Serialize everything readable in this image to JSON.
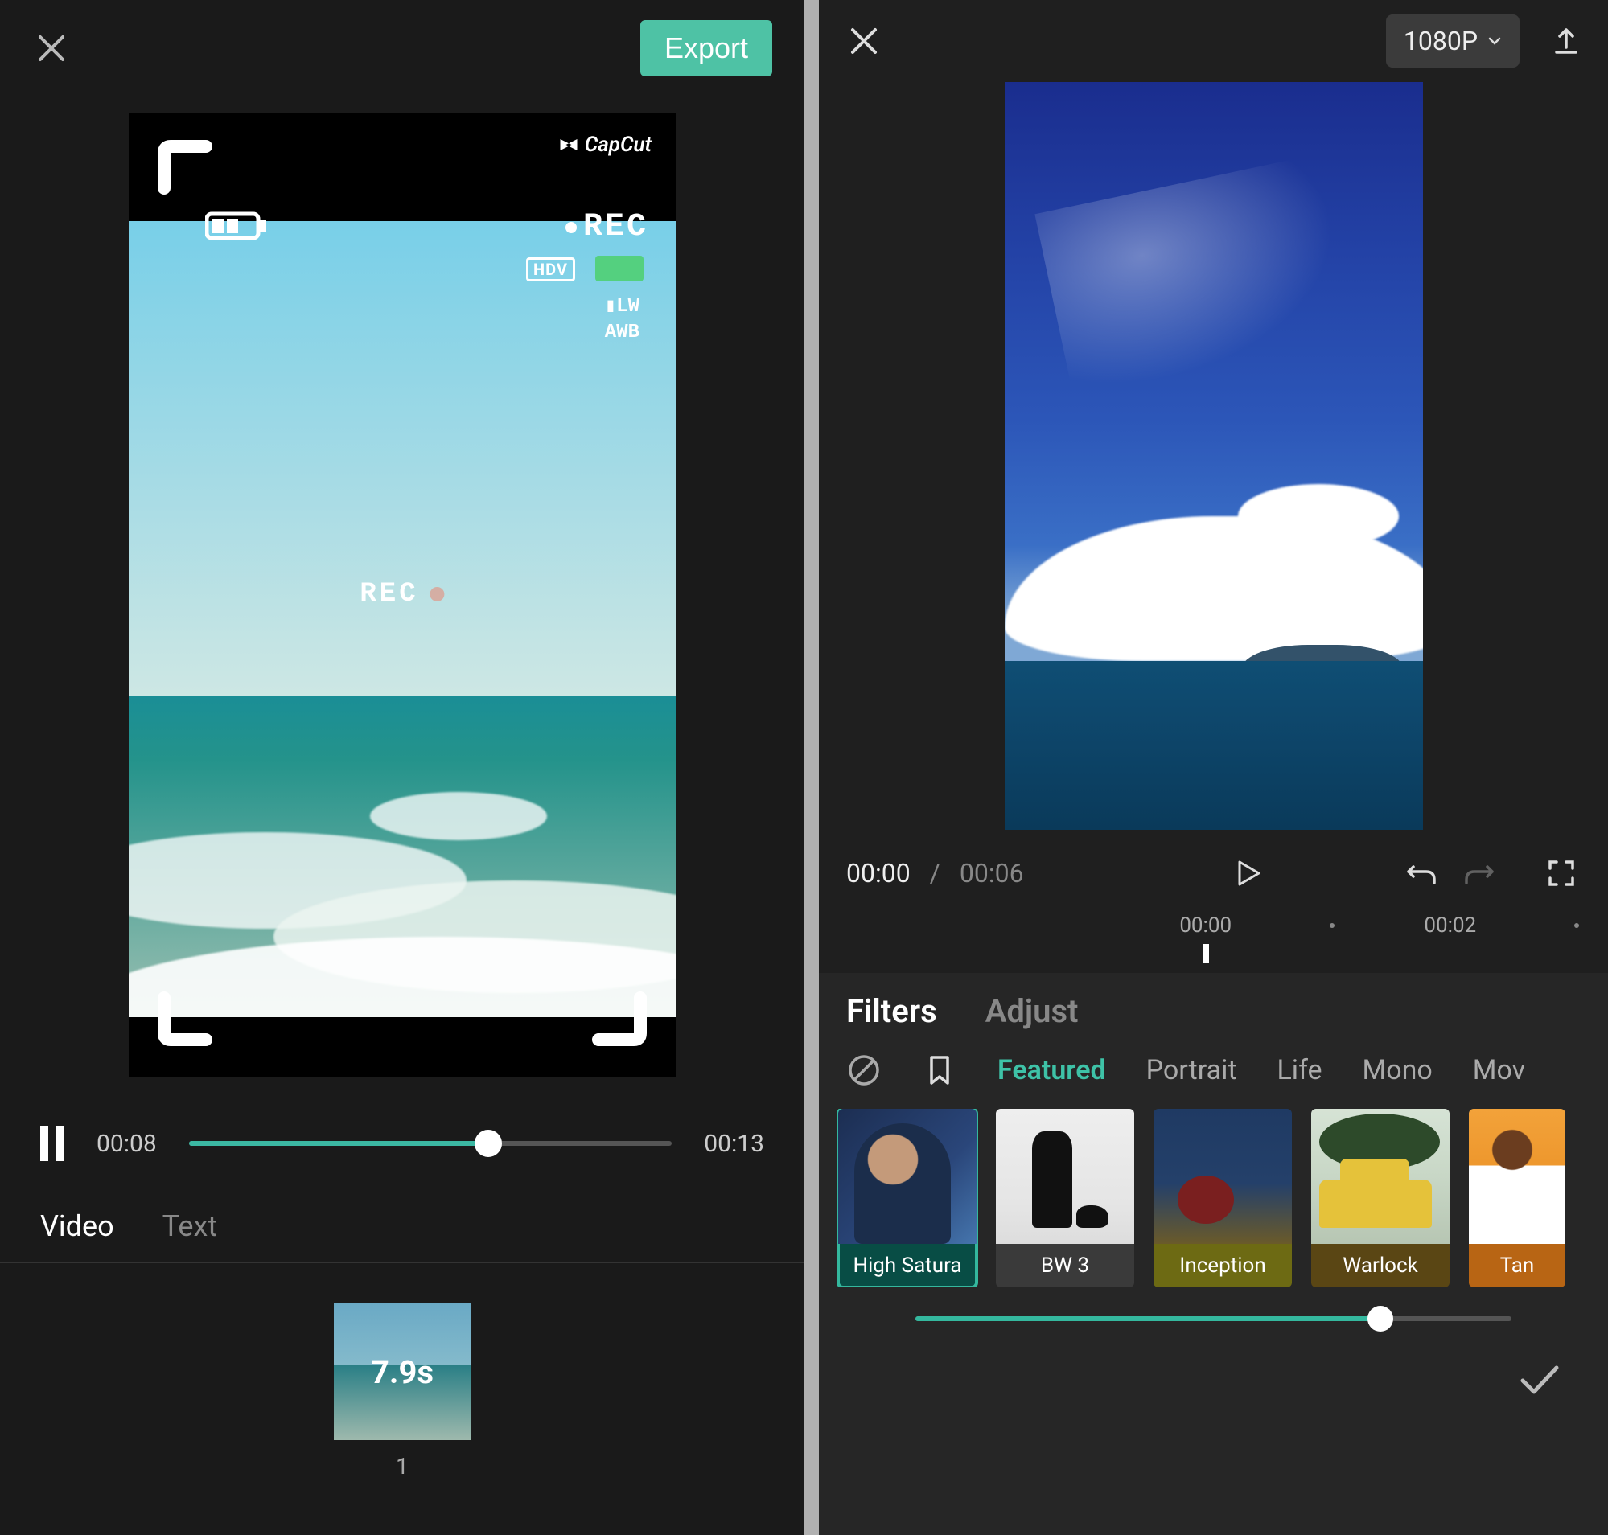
{
  "left": {
    "export_label": "Export",
    "overlay": {
      "brand": "CapCut",
      "rec_badge": "REC",
      "hdv": "HDV",
      "lw": "▮LW",
      "awb": "AWB",
      "rec_center": "REC"
    },
    "controls": {
      "current_time": "00:08",
      "total_time": "00:13",
      "progress_pct": 62
    },
    "tabs": {
      "video": "Video",
      "text": "Text",
      "active": "video"
    },
    "clip": {
      "duration_label": "7.9s",
      "index_label": "1"
    }
  },
  "right": {
    "resolution_label": "1080P",
    "controls": {
      "current_time": "00:00",
      "total_time": "00:06"
    },
    "timeline": {
      "ticks": [
        "00:00",
        "00:02"
      ]
    },
    "panel_tabs": {
      "filters": "Filters",
      "adjust": "Adjust",
      "active": "filters"
    },
    "categories": {
      "items": [
        "Featured",
        "Portrait",
        "Life",
        "Mono",
        "Mov"
      ],
      "active_index": 0
    },
    "filters": [
      {
        "label": "High Satura",
        "selected": true
      },
      {
        "label": "BW 3",
        "selected": false
      },
      {
        "label": "Inception",
        "selected": false
      },
      {
        "label": "Warlock",
        "selected": false
      },
      {
        "label": "Tan",
        "selected": false
      }
    ],
    "intensity_pct": 78
  }
}
